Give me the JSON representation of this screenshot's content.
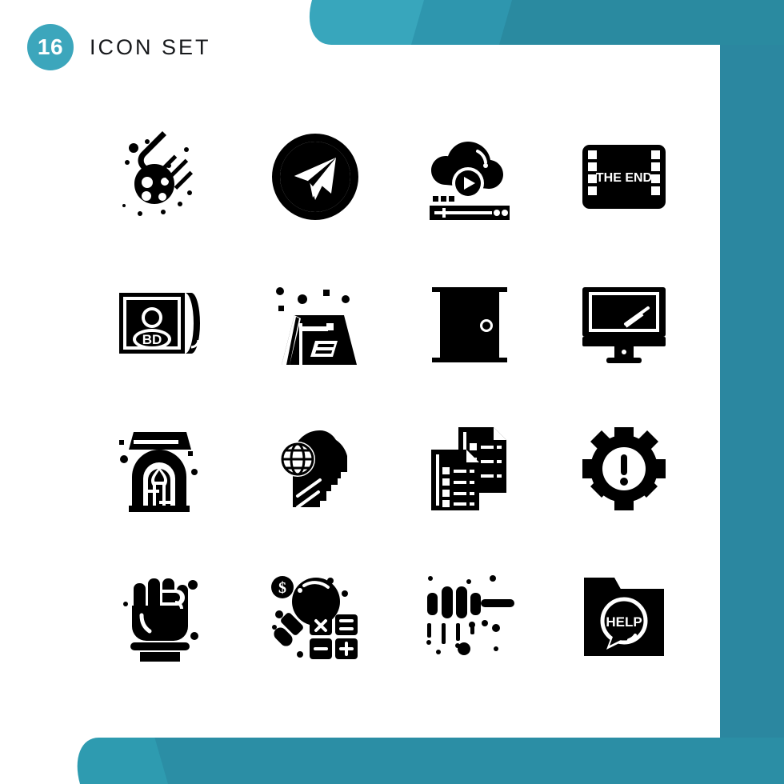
{
  "header": {
    "badge_count": "16",
    "title": "Icon Set"
  },
  "theme": {
    "accent": "#3CA6BC",
    "accent_mid": "#2E96AE",
    "accent_dark": "#2A8AA0",
    "band_right": "#2B87A0",
    "icon_color": "#000000",
    "background": "#FFFFFF"
  },
  "grid": {
    "columns": 4,
    "rows": 4,
    "total": 16
  },
  "icons": [
    {
      "index": 1,
      "name": "meteor-icon",
      "label": "Meteor",
      "row": 1,
      "col": 1,
      "text": ""
    },
    {
      "index": 2,
      "name": "send-circle-icon",
      "label": "Send",
      "row": 1,
      "col": 2,
      "text": ""
    },
    {
      "index": 3,
      "name": "cloud-video-icon",
      "label": "Cloud Video",
      "row": 1,
      "col": 3,
      "text": ""
    },
    {
      "index": 4,
      "name": "film-end-icon",
      "label": "The End",
      "row": 1,
      "col": 4,
      "text": "THE END"
    },
    {
      "index": 5,
      "name": "poster-profile-icon",
      "label": "Birthday Poster",
      "row": 2,
      "col": 1,
      "text": "BD"
    },
    {
      "index": 6,
      "name": "tent-icon",
      "label": "Tent",
      "row": 2,
      "col": 2,
      "text": ""
    },
    {
      "index": 7,
      "name": "door-icon",
      "label": "Door",
      "row": 2,
      "col": 3,
      "text": ""
    },
    {
      "index": 8,
      "name": "monitor-icon",
      "label": "Monitor",
      "row": 2,
      "col": 4,
      "text": ""
    },
    {
      "index": 9,
      "name": "fireplace-icon",
      "label": "Fireplace",
      "row": 3,
      "col": 1,
      "text": ""
    },
    {
      "index": 10,
      "name": "global-mind-icon",
      "label": "Global Thinking",
      "row": 3,
      "col": 2,
      "text": ""
    },
    {
      "index": 11,
      "name": "documents-icon",
      "label": "Documents",
      "row": 3,
      "col": 3,
      "text": ""
    },
    {
      "index": 12,
      "name": "gear-alert-icon",
      "label": "Settings Alert",
      "row": 3,
      "col": 4,
      "text": ""
    },
    {
      "index": 13,
      "name": "fist-icon",
      "label": "Fist",
      "row": 4,
      "col": 1,
      "text": ""
    },
    {
      "index": 14,
      "name": "finance-search-icon",
      "label": "Financial Search",
      "row": 4,
      "col": 2,
      "text": ""
    },
    {
      "index": 15,
      "name": "honey-dipper-icon",
      "label": "Honey Dipper",
      "row": 4,
      "col": 3,
      "text": ""
    },
    {
      "index": 16,
      "name": "help-folder-icon",
      "label": "Help Folder",
      "row": 4,
      "col": 4,
      "text": "HELP"
    }
  ]
}
